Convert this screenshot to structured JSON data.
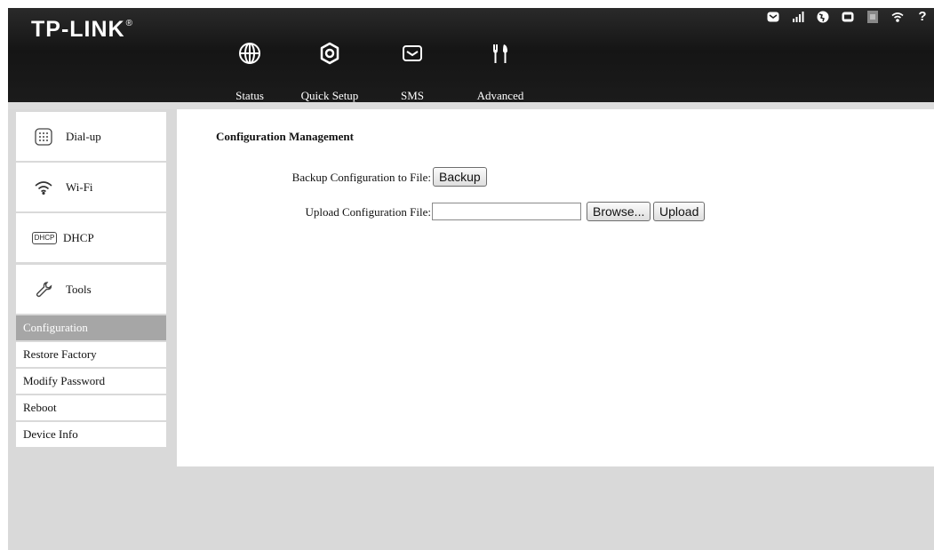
{
  "brand": {
    "logo": "TP-LINK",
    "registered": "®"
  },
  "nav": [
    {
      "label": "Status",
      "icon": "globe-icon"
    },
    {
      "label": "Quick Setup",
      "icon": "gear-icon"
    },
    {
      "label": "SMS",
      "icon": "envelope-icon"
    },
    {
      "label": "Advanced",
      "icon": "tools-icon"
    }
  ],
  "status_bar": [
    "message-icon",
    "signal-icon",
    "internet-icon",
    "battery-icon",
    "sim-icon",
    "wifi-icon",
    "help-icon"
  ],
  "sidebar": {
    "sections": [
      {
        "label": "Dial-up",
        "icon": "dialpad-icon"
      },
      {
        "label": "Wi-Fi",
        "icon": "wifi-icon"
      },
      {
        "label": "DHCP",
        "icon": "dhcp-icon"
      },
      {
        "label": "Tools",
        "icon": "wrench-icon"
      }
    ],
    "tools_items": [
      "Configuration",
      "Restore Factory",
      "Modify Password",
      "Reboot",
      "Device Info"
    ],
    "active_item": "Configuration",
    "dhcp_badge": "DHCP"
  },
  "main": {
    "title": "Configuration Management",
    "backup_label": "Backup Configuration to File:",
    "backup_button": "Backup",
    "upload_label": "Upload Configuration File:",
    "file_value": "",
    "browse_button": "Browse...",
    "upload_button": "Upload"
  },
  "colors": {
    "header": "#1b1b1b",
    "sidebar": "#d9d9d9",
    "active_item": "#a6a6a6"
  }
}
